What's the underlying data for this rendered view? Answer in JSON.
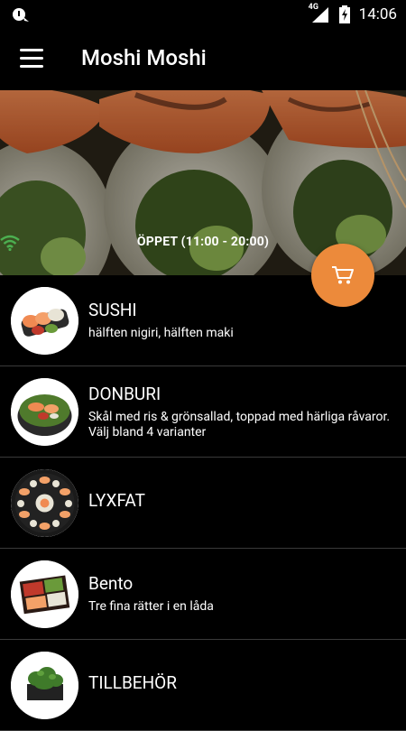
{
  "status_bar": {
    "network": "4G",
    "time": "14:06"
  },
  "app_bar": {
    "title": "Moshi Moshi",
    "menu_icon": "hamburger-icon"
  },
  "hero": {
    "status_icon": "wifi-icon",
    "open_status": "ÖPPET (11:00 - 20:00)"
  },
  "fab": {
    "icon": "cart-icon",
    "color": "#ec8a3b"
  },
  "categories": [
    {
      "title": "SUSHI",
      "subtitle": "hälften nigiri, hälften maki"
    },
    {
      "title": "DONBURI",
      "subtitle": "Skål med ris & grönsallad, toppad med härliga råvaror. Välj bland 4 varianter"
    },
    {
      "title": "LYXFAT",
      "subtitle": ""
    },
    {
      "title": "Bento",
      "subtitle": "Tre fina rätter i en låda"
    },
    {
      "title": "TILLBEHÖR",
      "subtitle": ""
    }
  ]
}
